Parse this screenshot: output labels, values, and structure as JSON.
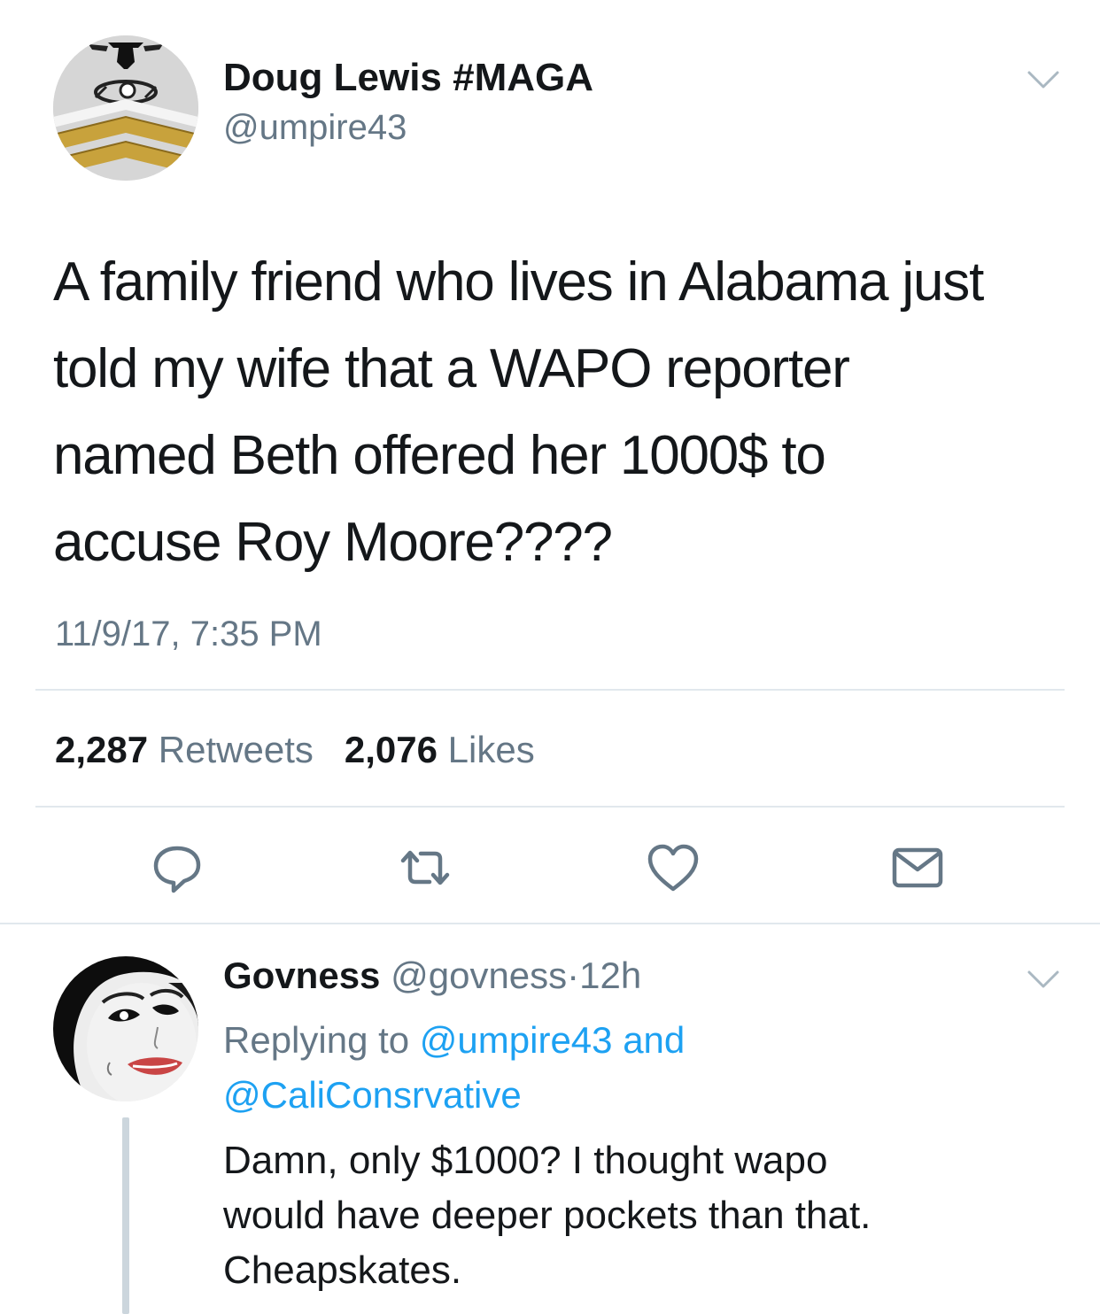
{
  "tweet": {
    "author_name": "Doug Lewis #MAGA",
    "author_handle": "@umpire43",
    "text_lines": [
      "A family friend who lives in Alabama  just",
      "told my wife that a WAPO reporter",
      "named Beth offered her 1000$ to",
      "accuse Roy Moore????"
    ],
    "timestamp": "11/9/17, 7:35 PM",
    "retweets_count": "2,287",
    "retweets_label": "Retweets",
    "likes_count": "2,076",
    "likes_label": "Likes"
  },
  "actions": {
    "reply_icon": "reply-bubble-icon",
    "retweet_icon": "retweet-icon",
    "like_icon": "heart-icon",
    "dm_icon": "envelope-icon"
  },
  "reply": {
    "author_name": "Govness",
    "author_handle": "@govness",
    "separator": "·",
    "time_ago": "12h",
    "replying_prefix": "Replying to",
    "replying_user1": "@umpire43",
    "replying_and": "and",
    "replying_user2": "@CaliConsrvative",
    "text_lines": [
      "Damn, only $1000? I thought wapo",
      "would have deeper pockets than that.",
      "Cheapskates."
    ]
  },
  "colors": {
    "text": "#14171a",
    "muted": "#657786",
    "link": "#1da1f2",
    "divider": "#e1e8ed"
  }
}
